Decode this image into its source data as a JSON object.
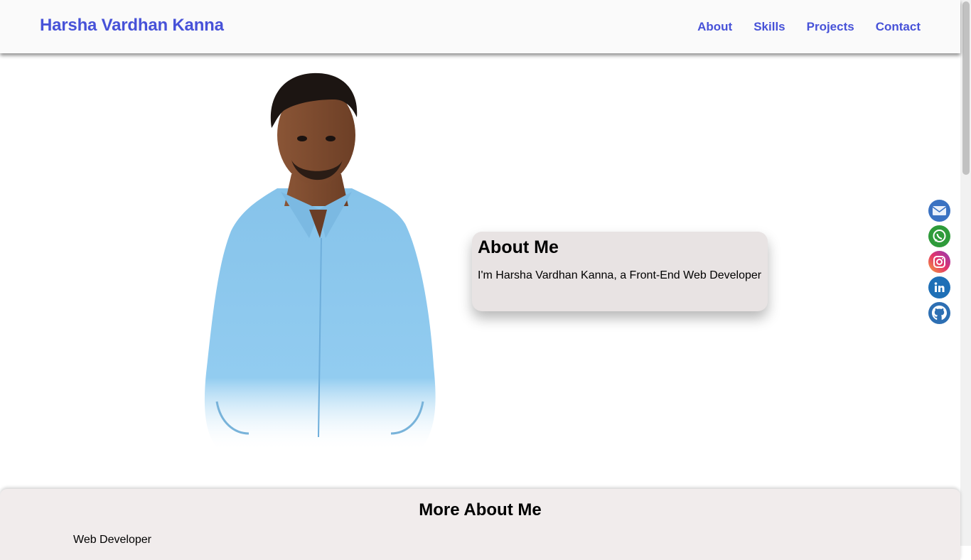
{
  "header": {
    "brand": "Harsha Vardhan Kanna",
    "nav": [
      "About",
      "Skills",
      "Projects",
      "Contact"
    ]
  },
  "about": {
    "heading": "About Me",
    "text": "I'm Harsha Vardhan Kanna, a Front-End Web Developer"
  },
  "social_icons": [
    "mail-icon",
    "whatsapp-icon",
    "instagram-icon",
    "linkedin-icon",
    "github-icon"
  ],
  "more": {
    "heading": "More About Me",
    "role": "Web Developer"
  },
  "colors": {
    "accent": "#4752d8",
    "card_bg": "#e8e3e3",
    "section_bg": "#f1ecec"
  }
}
